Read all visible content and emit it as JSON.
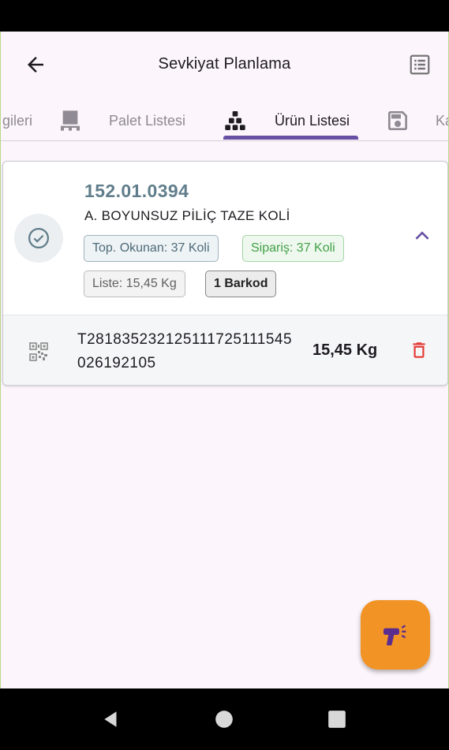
{
  "app_bar": {
    "title": "Sevkiyat Planlama"
  },
  "tabs": [
    {
      "label": "gileri"
    },
    {
      "label": "Palet Listesi"
    },
    {
      "label": "Ürün Listesi"
    },
    {
      "label": "Ka"
    }
  ],
  "product": {
    "code": "152.01.0394",
    "name": "A. BOYUNSUZ PİLİÇ TAZE KOLİ",
    "chips": {
      "read": "Top. Okunan: 37 Koli",
      "order": "Sipariş: 37 Koli",
      "list": "Liste: 15,45 Kg",
      "barcode_count": "1 Barkod"
    }
  },
  "barcode_item": {
    "barcode": "T281835232125111725111545026192105",
    "weight": "15,45 Kg"
  },
  "colors": {
    "accent": "#6750a4",
    "fab": "#f29325",
    "code": "#607d8b",
    "order_green": "#43a047",
    "delete_red": "#e53935"
  }
}
